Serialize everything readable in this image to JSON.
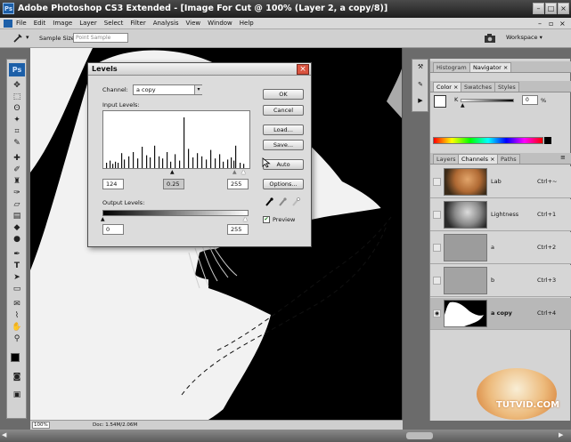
{
  "window": {
    "app_logo": "Ps",
    "title": "Adobe Photoshop CS3 Extended - [Image For Cut @ 100% (Layer 2, a copy/8)]",
    "minimize": "–",
    "maximize": "□",
    "close": "×"
  },
  "menubar": {
    "items": [
      "File",
      "Edit",
      "Image",
      "Layer",
      "Select",
      "Filter",
      "Analysis",
      "View",
      "Window",
      "Help"
    ]
  },
  "optionsbar": {
    "sample_size_label": "Sample Size:",
    "sample_size_value": "Point Sample",
    "workspace_label": "Workspace ▾"
  },
  "toolbox": {
    "logo": "Ps"
  },
  "levels": {
    "title": "Levels",
    "channel_label": "Channel:",
    "channel_value": "a copy",
    "input_levels_label": "Input Levels:",
    "input_black": "124",
    "input_gamma": "0.25",
    "input_white": "255",
    "output_levels_label": "Output Levels:",
    "output_black": "0",
    "output_white": "255",
    "buttons": {
      "ok": "OK",
      "cancel": "Cancel",
      "load": "Load...",
      "save": "Save...",
      "auto": "Auto",
      "options": "Options..."
    },
    "preview_label": "Preview",
    "preview_checked": true,
    "histogram_bars": [
      {
        "x": 0.02,
        "h": 0.1
      },
      {
        "x": 0.04,
        "h": 0.14
      },
      {
        "x": 0.06,
        "h": 0.08
      },
      {
        "x": 0.08,
        "h": 0.12
      },
      {
        "x": 0.1,
        "h": 0.1
      },
      {
        "x": 0.12,
        "h": 0.28
      },
      {
        "x": 0.14,
        "h": 0.16
      },
      {
        "x": 0.17,
        "h": 0.22
      },
      {
        "x": 0.2,
        "h": 0.3
      },
      {
        "x": 0.23,
        "h": 0.18
      },
      {
        "x": 0.26,
        "h": 0.4
      },
      {
        "x": 0.29,
        "h": 0.24
      },
      {
        "x": 0.32,
        "h": 0.2
      },
      {
        "x": 0.35,
        "h": 0.42
      },
      {
        "x": 0.38,
        "h": 0.22
      },
      {
        "x": 0.4,
        "h": 0.18
      },
      {
        "x": 0.43,
        "h": 0.3
      },
      {
        "x": 0.46,
        "h": 0.12
      },
      {
        "x": 0.49,
        "h": 0.26
      },
      {
        "x": 0.52,
        "h": 0.14
      },
      {
        "x": 0.55,
        "h": 0.95
      },
      {
        "x": 0.58,
        "h": 0.36
      },
      {
        "x": 0.61,
        "h": 0.2
      },
      {
        "x": 0.64,
        "h": 0.28
      },
      {
        "x": 0.67,
        "h": 0.22
      },
      {
        "x": 0.7,
        "h": 0.16
      },
      {
        "x": 0.73,
        "h": 0.34
      },
      {
        "x": 0.76,
        "h": 0.18
      },
      {
        "x": 0.79,
        "h": 0.26
      },
      {
        "x": 0.82,
        "h": 0.12
      },
      {
        "x": 0.85,
        "h": 0.16
      },
      {
        "x": 0.87,
        "h": 0.2
      },
      {
        "x": 0.89,
        "h": 0.14
      },
      {
        "x": 0.9,
        "h": 0.42
      },
      {
        "x": 0.93,
        "h": 0.1
      },
      {
        "x": 0.96,
        "h": 0.08
      }
    ]
  },
  "panels": {
    "group1_tabs": [
      "Histogram",
      "Navigator ×"
    ],
    "group2_tabs": [
      "Color ×",
      "Swatches",
      "Styles"
    ],
    "color_channel_label": "K",
    "color_value": "0",
    "color_unit": "%",
    "group3_tabs": [
      "Layers",
      "Channels ×",
      "Paths"
    ],
    "channels": [
      {
        "name": "Lab",
        "shortcut": "Ctrl+~",
        "visible": false
      },
      {
        "name": "Lightness",
        "shortcut": "Ctrl+1",
        "visible": false
      },
      {
        "name": "a",
        "shortcut": "Ctrl+2",
        "visible": false
      },
      {
        "name": "b",
        "shortcut": "Ctrl+3",
        "visible": false
      },
      {
        "name": "a copy",
        "shortcut": "Ctrl+4",
        "visible": true
      }
    ]
  },
  "statusbar": {
    "zoom": "100%",
    "doc_info": "Doc: 1.54M/2.06M"
  },
  "watermark": {
    "text": "TUTVID.COM"
  }
}
